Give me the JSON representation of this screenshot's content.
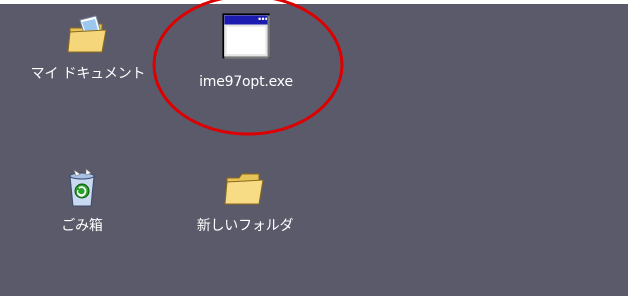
{
  "desktop": {
    "background_color": "#5a5a6b",
    "icons": [
      {
        "label": "マイ ドキュメント",
        "icon": "my-documents-folder-icon"
      },
      {
        "label": "ime97opt.exe",
        "icon": "application-window-icon"
      },
      {
        "label": "ごみ箱",
        "icon": "recycle-bin-icon"
      },
      {
        "label": "新しいフォルダ",
        "icon": "folder-icon"
      }
    ]
  },
  "annotation": {
    "shape": "ellipse",
    "color": "#dd0000"
  }
}
